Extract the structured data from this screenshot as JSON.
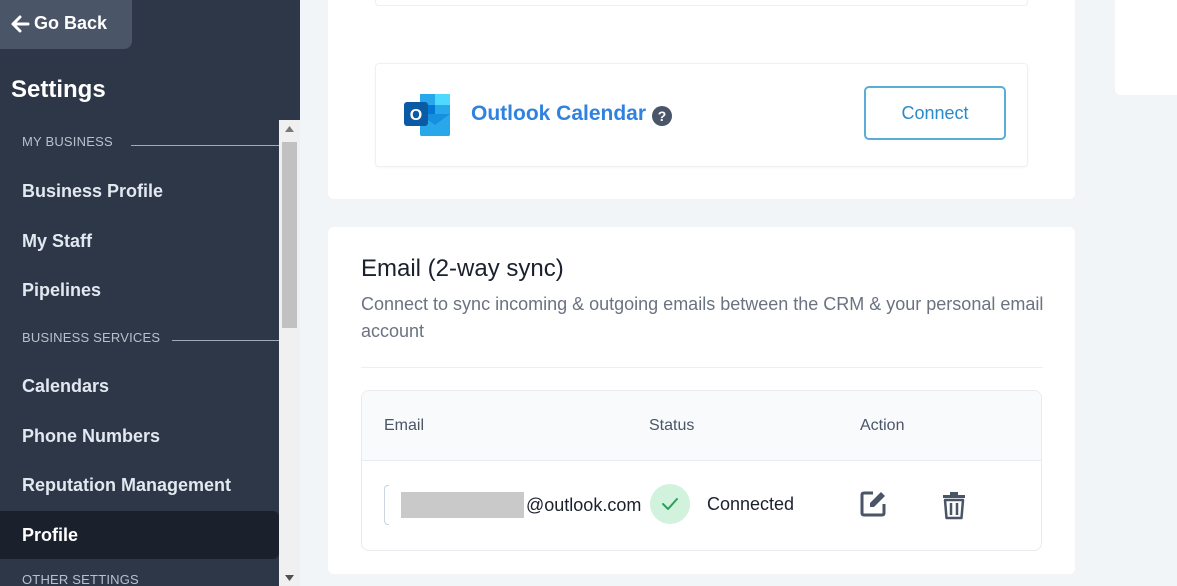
{
  "sidebar": {
    "go_back_label": "Go Back",
    "title": "Settings",
    "sections": {
      "my_business": "MY BUSINESS",
      "business_services": "BUSINESS SERVICES",
      "other_settings": "OTHER SETTINGS"
    },
    "items": {
      "business_profile": "Business Profile",
      "my_staff": "My Staff",
      "pipelines": "Pipelines",
      "calendars": "Calendars",
      "phone_numbers": "Phone Numbers",
      "reputation_management": "Reputation Management",
      "profile": "Profile"
    },
    "active_item": "Profile"
  },
  "outlook": {
    "name": "Outlook Calendar",
    "help_symbol": "?",
    "connect_label": "Connect",
    "logo_letter": "O"
  },
  "email_sync": {
    "title": "Email (2-way sync)",
    "description": "Connect to sync incoming & outgoing emails between the CRM & your personal email account",
    "columns": {
      "email": "Email",
      "status": "Status",
      "action": "Action"
    },
    "rows": [
      {
        "email_domain": "@outlook.com",
        "status": "Connected"
      }
    ]
  },
  "colors": {
    "sidebar_bg": "#2d3748",
    "accent_blue": "#3182e0",
    "connected_green": "#d1f2dc"
  },
  "icons": [
    "arrow-left-icon",
    "outlook-logo-icon",
    "help-icon",
    "check-icon",
    "edit-icon",
    "trash-icon"
  ]
}
